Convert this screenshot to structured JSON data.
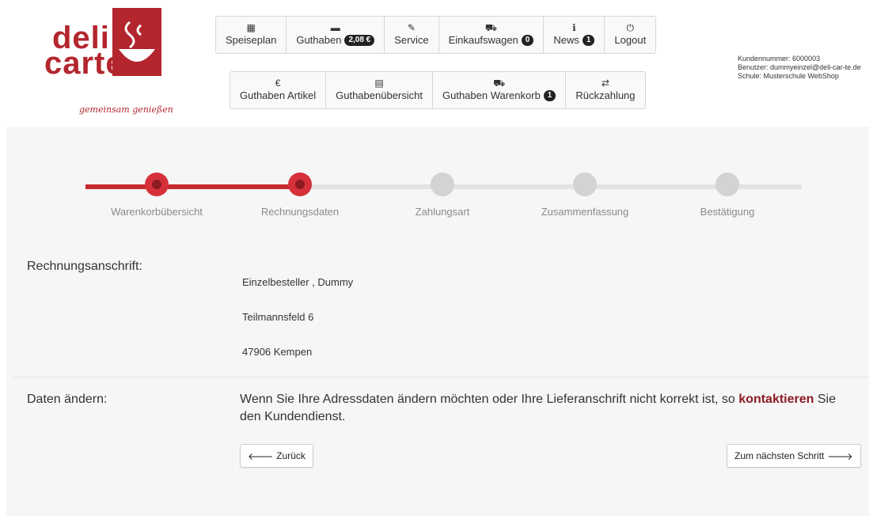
{
  "brand": {
    "word1": "deli",
    "word2": "carte",
    "tagline": "gemeinsam genießen",
    "color": "#b3262e"
  },
  "nav_primary": [
    {
      "icon": "calendar-icon",
      "glyph": "▦",
      "label": "Speiseplan",
      "badge": ""
    },
    {
      "icon": "credit-card-icon",
      "glyph": "▬",
      "label": "Guthaben",
      "badge": "2,08 €"
    },
    {
      "icon": "pencil-icon",
      "glyph": "✎",
      "label": "Service",
      "badge": ""
    },
    {
      "icon": "cart-icon",
      "glyph": "⛟",
      "label": "Einkaufswagen",
      "badge": "0"
    },
    {
      "icon": "info-icon",
      "glyph": "ℹ",
      "label": "News",
      "badge": "1"
    },
    {
      "icon": "power-icon",
      "glyph": "⏻",
      "label": "Logout",
      "badge": ""
    }
  ],
  "nav_secondary": [
    {
      "icon": "euro-icon",
      "glyph": "€",
      "label": "Guthaben Artikel",
      "badge": ""
    },
    {
      "icon": "list-icon",
      "glyph": "▤",
      "label": "Guthabenübersicht",
      "badge": ""
    },
    {
      "icon": "cart-icon",
      "glyph": "⛟",
      "label": "Guthaben Warenkorb",
      "badge": "1"
    },
    {
      "icon": "retweet-icon",
      "glyph": "⇄",
      "label": "Rückzahlung",
      "badge": ""
    }
  ],
  "customer": {
    "number": "Kundennummer: 6000003",
    "user": "Benutzer: dummyeinzel@deli-car-te.de",
    "school": "Schule: Musterschule WebShop"
  },
  "steps": [
    {
      "label": "Warenkorbübersicht",
      "state": "done"
    },
    {
      "label": "Rechnungsdaten",
      "state": "active"
    },
    {
      "label": "Zahlungsart",
      "state": "todo"
    },
    {
      "label": "Zusammenfassung",
      "state": "todo"
    },
    {
      "label": "Bestätigung",
      "state": "todo"
    }
  ],
  "billing": {
    "heading": "Rechnungsanschrift:",
    "name": "Einzelbesteller , Dummy",
    "street": "Teilmannsfeld 6",
    "city": "47906 Kempen"
  },
  "change": {
    "heading": "Daten ändern:",
    "text_before": "Wenn Sie Ihre Adressdaten ändern möchten oder Ihre Lieferanschrift nicht korrekt ist, so",
    "link": "kontaktieren",
    "text_after": "Sie den Kundendienst."
  },
  "buttons": {
    "back": "Zurück",
    "next": "Zum nächsten Schritt"
  },
  "colors": {
    "accent": "#c8282f",
    "accent_dark": "#8c1b22",
    "step_inactive": "#d3d3d3"
  }
}
